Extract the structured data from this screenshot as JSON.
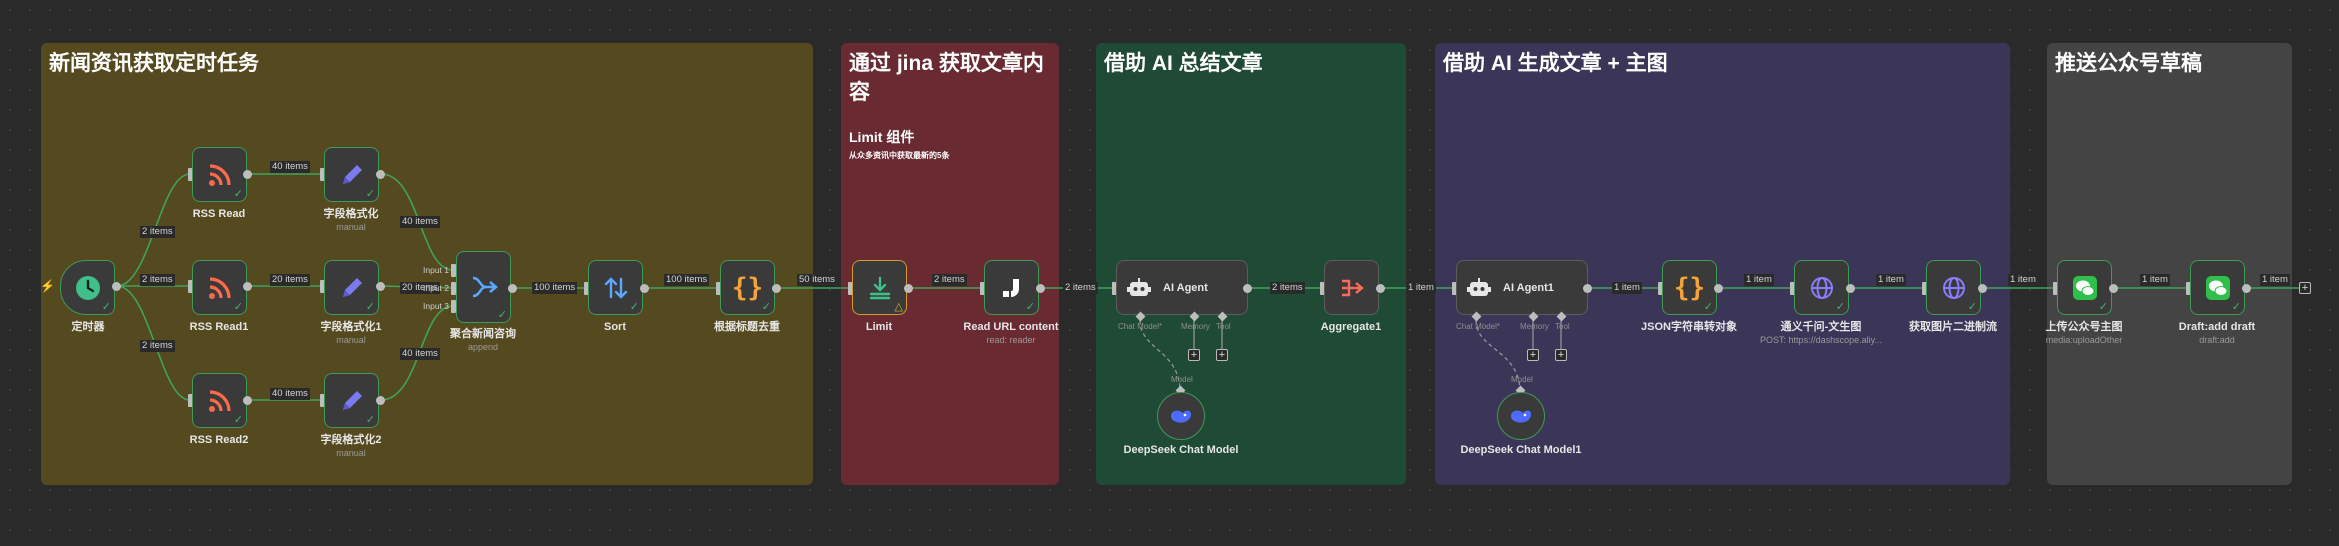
{
  "colors": {
    "group1": "#55491f",
    "group2": "#6a2a32",
    "group3": "#1f4a35",
    "group4": "#3b3558",
    "group5": "#444444",
    "wire": "#3fa35a",
    "port": "#bdbdbd"
  },
  "groups": [
    {
      "title": "新闻资讯获取定时任务"
    },
    {
      "title": "通过 jina 获取文章内容",
      "subtitle": "Limit 组件",
      "note": "从众多资讯中获取最新的5条"
    },
    {
      "title": "借助 AI 总结文章"
    },
    {
      "title": "借助 AI 生成文章 + 主图"
    },
    {
      "title": "推送公众号草稿"
    }
  ],
  "nodes": {
    "trigger": {
      "label": "定时器",
      "icon": "clock-icon"
    },
    "rss_read": {
      "label": "RSS Read",
      "icon": "rss-icon"
    },
    "rss_read1": {
      "label": "RSS Read1",
      "icon": "rss-icon"
    },
    "rss_read2": {
      "label": "RSS Read2",
      "icon": "rss-icon"
    },
    "fmt": {
      "label": "字段格式化",
      "sub": "manual",
      "icon": "pencil-icon"
    },
    "fmt1": {
      "label": "字段格式化1",
      "sub": "manual",
      "icon": "pencil-icon"
    },
    "fmt2": {
      "label": "字段格式化2",
      "sub": "manual",
      "icon": "pencil-icon"
    },
    "merge": {
      "label": "聚合新闻咨询",
      "sub": "append",
      "icon": "merge-icon",
      "inputs": [
        "Input 1",
        "Input 2",
        "Input 3"
      ]
    },
    "sort": {
      "label": "Sort",
      "icon": "sort-icon"
    },
    "dedup": {
      "label": "根据标题去重",
      "icon": "braces-icon"
    },
    "limit": {
      "label": "Limit",
      "icon": "limit-icon"
    },
    "read_url": {
      "label": "Read URL content",
      "sub": "read: reader",
      "icon": "jina-icon"
    },
    "agent": {
      "label": "AI Agent",
      "icon": "robot-icon",
      "slots": [
        "Chat Model*",
        "Memory",
        "Tool"
      ]
    },
    "deepseek": {
      "label": "DeepSeek Chat Model",
      "slot": "Model",
      "icon": "whale-icon"
    },
    "aggregate": {
      "label": "Aggregate1",
      "icon": "aggregate-icon"
    },
    "agent1": {
      "label": "AI Agent1",
      "icon": "robot-icon",
      "slots": [
        "Chat Model*",
        "Memory",
        "Tool"
      ]
    },
    "deepseek1": {
      "label": "DeepSeek Chat Model1",
      "slot": "Model",
      "icon": "whale-icon"
    },
    "json": {
      "label": "JSON字符串转对象",
      "icon": "braces-icon"
    },
    "tongyi": {
      "label": "通义千问-文生图",
      "sub": "POST: https://dashscope.aliy...",
      "icon": "globe-icon"
    },
    "getimg": {
      "label": "获取图片二进制流",
      "icon": "globe-icon"
    },
    "upload": {
      "label": "上传公众号主图",
      "sub": "media:uploadOther",
      "icon": "wechat-icon"
    },
    "draft": {
      "label": "Draft:add draft",
      "sub": "draft:add",
      "icon": "wechat-icon"
    }
  },
  "edge_labels": {
    "trigger_rss": "2 items",
    "trigger_rss1": "2 items",
    "trigger_rss2": "2 items",
    "rss_fmt": "40 items",
    "rss1_fmt1": "20 items",
    "rss2_fmt2": "40 items",
    "fmt_merge": "40 items",
    "fmt1_merge": "20 items",
    "fmt2_merge": "40 items",
    "merge_sort": "100 items",
    "sort_dedup": "100 items",
    "dedup_limit": "50 items",
    "limit_read": "2 items",
    "read_agent": "2 items",
    "agent_agg": "2 items",
    "agg_agent1": "1 item",
    "agent1_json": "1 item",
    "json_tongyi": "1 item",
    "tongyi_getimg": "1 item",
    "getimg_upload": "1 item",
    "upload_draft": "1 item",
    "draft_end": "1 item"
  },
  "add_button": "+"
}
